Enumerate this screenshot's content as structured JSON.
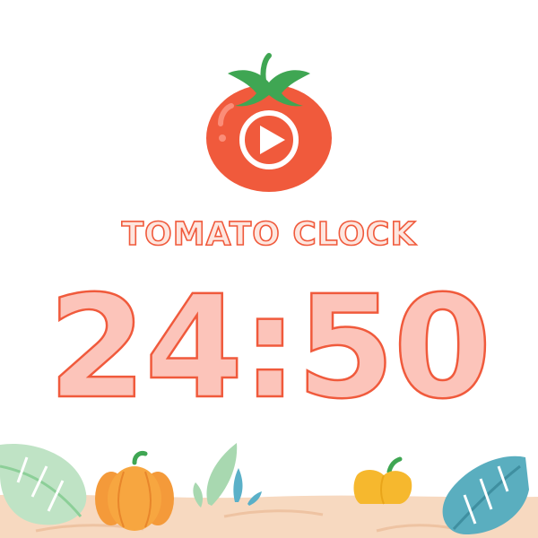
{
  "app": {
    "title": "TOMATO CLOCK",
    "timer": "24:50"
  },
  "controls": {
    "play_icon": "play-icon"
  },
  "colors": {
    "accent": "#f05a3c",
    "tomato": "#f05a3c",
    "leaf": "#3fa653",
    "timer_fill": "#fcc4ba",
    "ground": "#f7d9c0"
  },
  "decor": [
    "monstera-leaf-icon",
    "pumpkin-icon",
    "sprout-icon",
    "bell-pepper-icon"
  ]
}
